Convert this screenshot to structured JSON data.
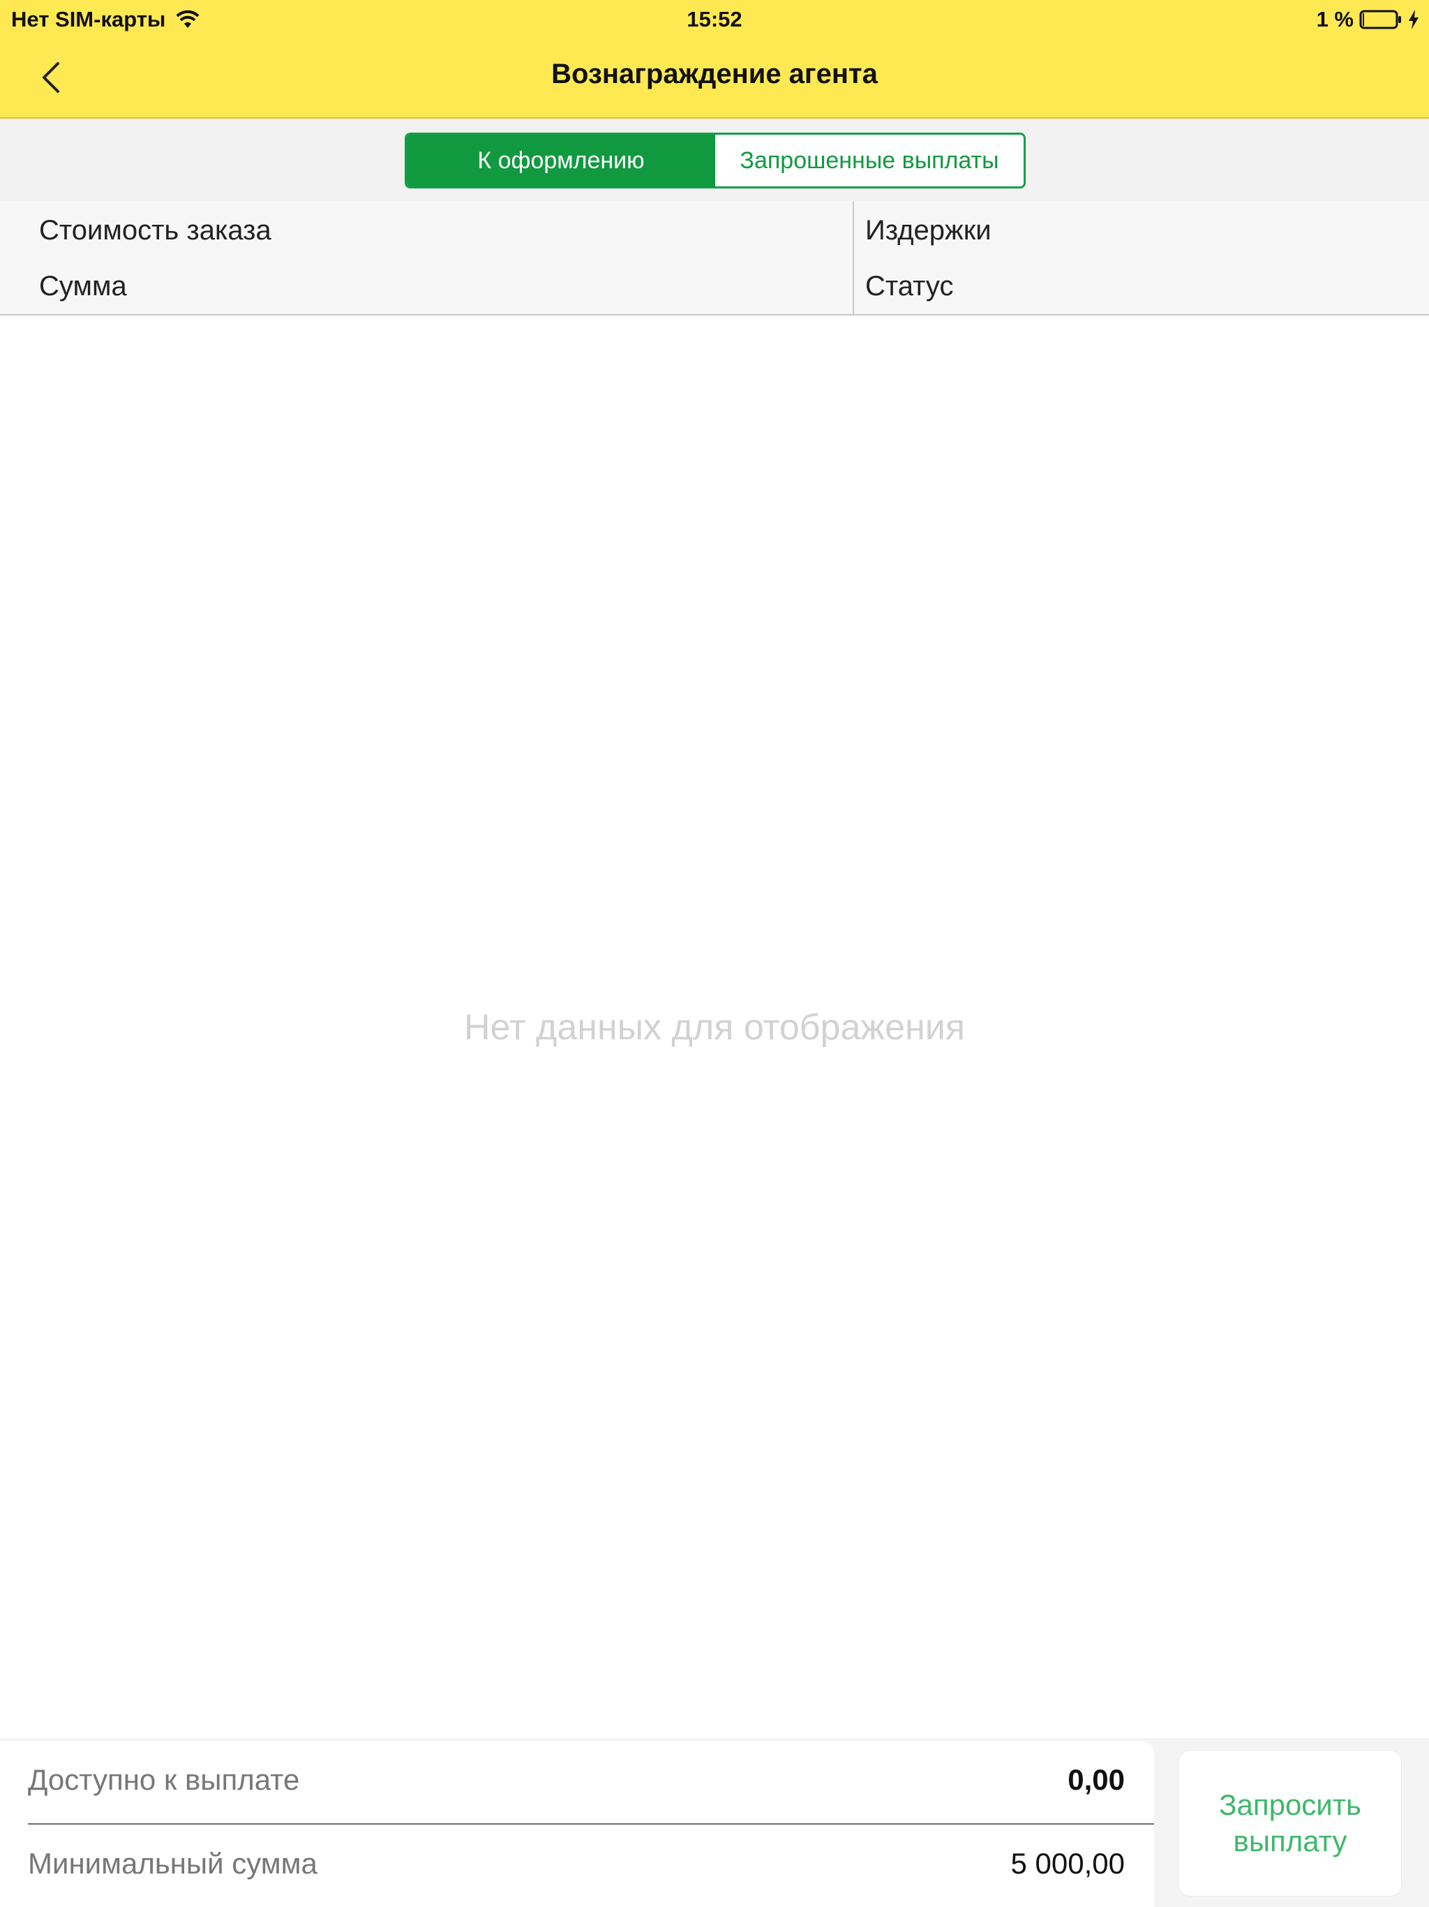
{
  "status_bar": {
    "carrier": "Нет SIM-карты",
    "time": "15:52",
    "battery_percent": "1 %",
    "battery_level": 0.01,
    "icons": [
      "wifi-icon",
      "battery-icon",
      "charging-bolt-icon"
    ]
  },
  "nav": {
    "title": "Вознаграждение агента",
    "back_icon": "chevron-left-icon"
  },
  "tabs": [
    {
      "label": "К оформлению",
      "active": true
    },
    {
      "label": "Запрошенные выплаты",
      "active": false
    }
  ],
  "table": {
    "columns_left": [
      "Стоимость заказа",
      "Сумма"
    ],
    "columns_right": [
      "Издержки",
      "Статус"
    ],
    "empty_text": "Нет данных для отображения"
  },
  "summary": {
    "available_label": "Доступно к выплате",
    "available_value": "0,00",
    "minimum_label": "Минимальный сумма",
    "minimum_value": "5 000,00",
    "request_button": "Запросить выплату"
  },
  "colors": {
    "header_yellow": "#fee952",
    "accent_green": "#11993f",
    "button_text_green": "#3eb86a",
    "empty_text_gray": "#d2d2d2"
  }
}
